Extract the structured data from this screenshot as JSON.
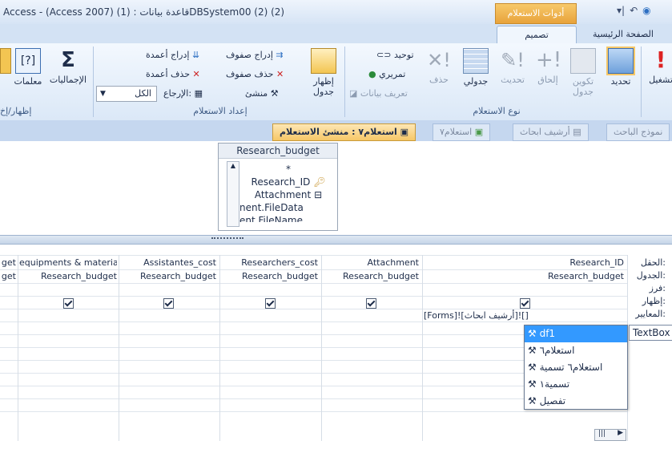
{
  "window": {
    "title": "Access - (Access 2007) قاعدة بيانات : (1)DBSystem00 (2) (2)",
    "contextual_tab_group": "أدوات الاستعلام",
    "qat_icons": [
      "undo-icon",
      "dropdown-icon",
      "customize-icon",
      "office-button-icon"
    ]
  },
  "ribbon_tabs": [
    {
      "label": "الصفحة الرئيسية",
      "active": false
    },
    {
      "label": "تصميم",
      "active": true
    }
  ],
  "ribbon": {
    "query_type_group": {
      "label": "نوع الاستعلام",
      "buttons": [
        {
          "label": "تحديد",
          "icon": "select-query-icon",
          "enabled": true
        },
        {
          "label": "تكوين جدول",
          "icon": "make-table-icon",
          "enabled": false
        },
        {
          "label": "إلحاق",
          "icon": "append-icon",
          "enabled": false
        },
        {
          "label": "تحديث",
          "icon": "update-icon",
          "enabled": false
        },
        {
          "label": "جدولي",
          "icon": "crosstab-icon",
          "enabled": true
        },
        {
          "label": "حذف",
          "icon": "delete-icon",
          "enabled": false
        }
      ],
      "small": [
        "توحيد",
        "تمريري",
        "تعريف بيانات"
      ]
    },
    "query_setup_group": {
      "label": "إعداد الاستعلام",
      "show_table": "إظهار جدول",
      "insert_rows": "إدراج صفوف",
      "delete_rows": "حذف صفوف",
      "builder": "منشئ",
      "insert_columns": "إدراج أعمدة",
      "delete_columns": "حذف أعمدة",
      "return_label": "الإرجاع:",
      "return_value": "الكل"
    },
    "show_hide_group": {
      "label": "إظهار/إخ",
      "totals": "الإجماليات",
      "parameters": "معلمات"
    },
    "results_partial": "تشغيل"
  },
  "doc_tabs": [
    {
      "label": "استعلام٧ : منشئ الاستعلام",
      "active": true
    },
    {
      "label": "استعلام٧",
      "active": false
    },
    {
      "label": "أرشيف ابحاث",
      "active": false
    },
    {
      "label": "نموذج الباحث",
      "active": false
    }
  ],
  "table_box": {
    "title": "Research_budget",
    "fields": [
      "*",
      "Research_ID",
      "Attachment",
      "nent.FileData",
      "ent.FileName"
    ]
  },
  "grid": {
    "row_labels": [
      "الحقل:",
      "الجدول:",
      "فرز:",
      "إظهار:",
      "المعايير:"
    ],
    "columns": [
      {
        "field": "Research_ID",
        "table": "Research_budget",
        "show": true,
        "criteria": "[Forms]![أرشيف ابحاث]![]"
      },
      {
        "field": "Attachment",
        "table": "Research_budget",
        "show": true,
        "criteria": ""
      },
      {
        "field": "Researchers_cost",
        "table": "Research_budget",
        "show": true,
        "criteria": ""
      },
      {
        "field": "Assistantes_cost",
        "table": "Research_budget",
        "show": true,
        "criteria": ""
      },
      {
        "field": "equipments & materials",
        "table": "Research_budget",
        "show": true,
        "criteria": ""
      },
      {
        "field": "get",
        "table": "get",
        "show": false,
        "criteria": ""
      }
    ]
  },
  "autocomplete": {
    "items": [
      "df1",
      "استعلام٦",
      "استعلام٦ تسمية",
      "تسمية١",
      "تفصيل"
    ],
    "selected_index": 0,
    "tooltip": "TextBox"
  }
}
